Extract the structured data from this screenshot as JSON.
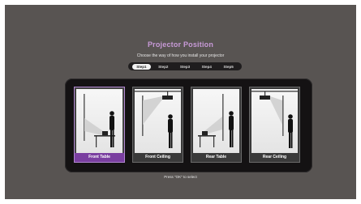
{
  "title": "Projector Position",
  "subtitle": "Choose the way of how you install your projector",
  "steps": [
    "Step1",
    "Step2",
    "Step3",
    "Step4",
    "Step5"
  ],
  "options": [
    {
      "label": "Front Table"
    },
    {
      "label": "Front Ceiling"
    },
    {
      "label": "Rear Table"
    },
    {
      "label": "Rear Ceiling"
    }
  ],
  "hint": "Press \"OK\" to select",
  "colors": {
    "accent": "#c89ad8",
    "selected_label_bg": "#7a3fa0",
    "screen_bg": "#585452",
    "panel_bg": "#141213"
  }
}
